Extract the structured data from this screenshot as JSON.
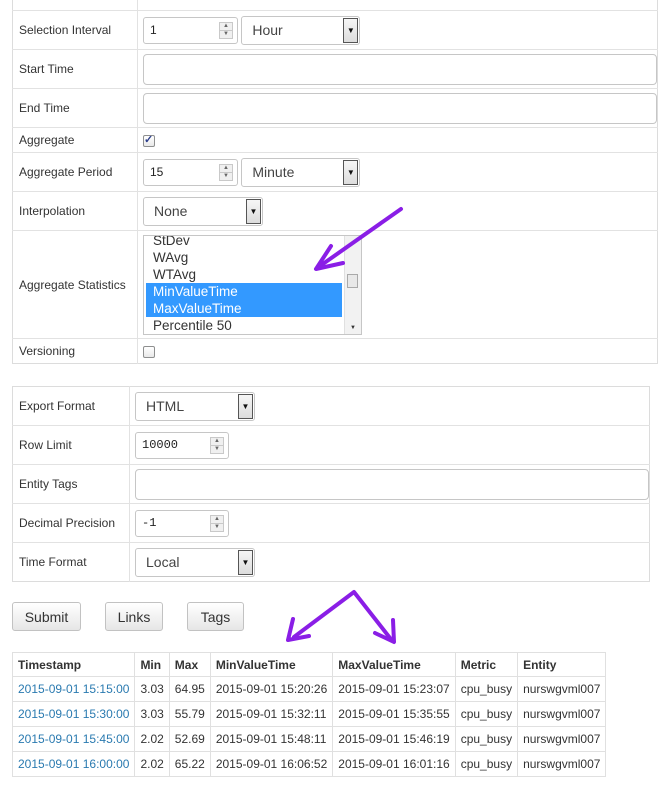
{
  "query_form": {
    "selection_interval": {
      "label": "Selection Interval",
      "count": "1",
      "unit": "Hour"
    },
    "start_time": {
      "label": "Start Time",
      "value": ""
    },
    "end_time": {
      "label": "End Time",
      "value": ""
    },
    "aggregate": {
      "label": "Aggregate",
      "checked": true
    },
    "aggregate_period": {
      "label": "Aggregate Period",
      "count": "15",
      "unit": "Minute"
    },
    "interpolation": {
      "label": "Interpolation",
      "value": "None"
    },
    "aggregate_statistics": {
      "label": "Aggregate Statistics",
      "options": [
        {
          "label": "StDev",
          "selected": false
        },
        {
          "label": "WAvg",
          "selected": false
        },
        {
          "label": "WTAvg",
          "selected": false
        },
        {
          "label": "MinValueTime",
          "selected": true
        },
        {
          "label": "MaxValueTime",
          "selected": true
        },
        {
          "label": "Percentile 50",
          "selected": false
        }
      ]
    },
    "versioning": {
      "label": "Versioning",
      "checked": false
    }
  },
  "export_form": {
    "export_format": {
      "label": "Export Format",
      "value": "HTML"
    },
    "row_limit": {
      "label": "Row Limit",
      "value": "10000"
    },
    "entity_tags": {
      "label": "Entity Tags",
      "value": ""
    },
    "decimal_precision": {
      "label": "Decimal Precision",
      "value": "-1"
    },
    "time_format": {
      "label": "Time Format",
      "value": "Local"
    }
  },
  "actions": {
    "submit": "Submit",
    "links": "Links",
    "tags": "Tags"
  },
  "results": {
    "columns": [
      "Timestamp",
      "Min",
      "Max",
      "MinValueTime",
      "MaxValueTime",
      "Metric",
      "Entity"
    ],
    "rows": [
      [
        "2015-09-01 15:15:00",
        "3.03",
        "64.95",
        "2015-09-01 15:20:26",
        "2015-09-01 15:23:07",
        "cpu_busy",
        "nurswgvml007"
      ],
      [
        "2015-09-01 15:30:00",
        "3.03",
        "55.79",
        "2015-09-01 15:32:11",
        "2015-09-01 15:35:55",
        "cpu_busy",
        "nurswgvml007"
      ],
      [
        "2015-09-01 15:45:00",
        "2.02",
        "52.69",
        "2015-09-01 15:48:11",
        "2015-09-01 15:46:19",
        "cpu_busy",
        "nurswgvml007"
      ],
      [
        "2015-09-01 16:00:00",
        "2.02",
        "65.22",
        "2015-09-01 16:06:52",
        "2015-09-01 16:01:16",
        "cpu_busy",
        "nurswgvml007"
      ]
    ]
  },
  "colors": {
    "selection": "#3399ff",
    "link": "#2a7ab0",
    "annotation_arrow": "#8a1ee6"
  },
  "icons": [
    "spinner-up-icon",
    "spinner-down-icon",
    "dropdown-arrow-icon",
    "checkmark-icon",
    "annotation-arrow"
  ]
}
